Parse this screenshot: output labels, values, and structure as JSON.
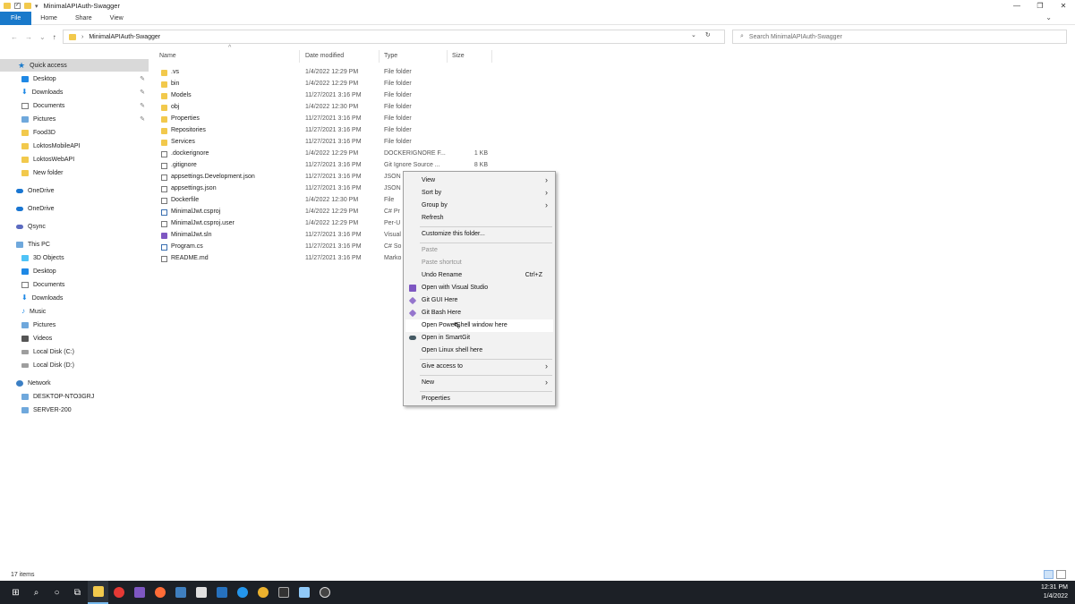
{
  "window": {
    "title": "MinimalAPIAuth-Swagger",
    "controls": [
      "—",
      "❐",
      "✕"
    ]
  },
  "ribbon": {
    "tabs": [
      "File",
      "Home",
      "Share",
      "View"
    ]
  },
  "address": {
    "path": "MinimalAPIAuth-Swagger",
    "search_placeholder": "Search MinimalAPIAuth-Swagger"
  },
  "sidebar": {
    "items": [
      {
        "label": "Quick access",
        "icon": "star-icon"
      },
      {
        "label": "Desktop",
        "icon": "desktop-icon",
        "pinned": true
      },
      {
        "label": "Downloads",
        "icon": "downloads-icon",
        "pinned": true
      },
      {
        "label": "Documents",
        "icon": "documents-icon",
        "pinned": true
      },
      {
        "label": "Pictures",
        "icon": "pictures-icon",
        "pinned": true
      },
      {
        "label": "Food3D",
        "icon": "folder-icon"
      },
      {
        "label": "LoktosMobileAPI",
        "icon": "folder-icon"
      },
      {
        "label": "LoktosWebAPI",
        "icon": "folder-icon"
      },
      {
        "label": "New folder",
        "icon": "folder-icon"
      },
      {
        "label": "OneDrive",
        "icon": "onedrive-icon"
      },
      {
        "label": "OneDrive",
        "icon": "onedrive-icon"
      },
      {
        "label": "Qsync",
        "icon": "qsync-icon"
      },
      {
        "label": "This PC",
        "icon": "pc-icon"
      },
      {
        "label": "3D Objects",
        "icon": "3d-objects-icon"
      },
      {
        "label": "Desktop",
        "icon": "desktop-icon"
      },
      {
        "label": "Documents",
        "icon": "documents-icon"
      },
      {
        "label": "Downloads",
        "icon": "downloads-icon"
      },
      {
        "label": "Music",
        "icon": "music-icon"
      },
      {
        "label": "Pictures",
        "icon": "pictures-icon"
      },
      {
        "label": "Videos",
        "icon": "videos-icon"
      },
      {
        "label": "Local Disk (C:)",
        "icon": "drive-icon"
      },
      {
        "label": "Local Disk (D:)",
        "icon": "drive-icon"
      },
      {
        "label": "Network",
        "icon": "network-icon"
      },
      {
        "label": "DESKTOP-NTO3GRJ",
        "icon": "computer-icon"
      },
      {
        "label": "SERVER-200",
        "icon": "computer-icon"
      }
    ]
  },
  "columns": {
    "name": "Name",
    "date": "Date modified",
    "type": "Type",
    "size": "Size"
  },
  "files": [
    {
      "name": ".vs",
      "date": "1/4/2022 12:29 PM",
      "type": "File folder",
      "size": "",
      "kind": "folder"
    },
    {
      "name": "bin",
      "date": "1/4/2022 12:29 PM",
      "type": "File folder",
      "size": "",
      "kind": "folder"
    },
    {
      "name": "Models",
      "date": "11/27/2021 3:16 PM",
      "type": "File folder",
      "size": "",
      "kind": "folder"
    },
    {
      "name": "obj",
      "date": "1/4/2022 12:30 PM",
      "type": "File folder",
      "size": "",
      "kind": "folder"
    },
    {
      "name": "Properties",
      "date": "11/27/2021 3:16 PM",
      "type": "File folder",
      "size": "",
      "kind": "folder"
    },
    {
      "name": "Repositories",
      "date": "11/27/2021 3:16 PM",
      "type": "File folder",
      "size": "",
      "kind": "folder"
    },
    {
      "name": "Services",
      "date": "11/27/2021 3:16 PM",
      "type": "File folder",
      "size": "",
      "kind": "folder"
    },
    {
      "name": ".dockerignore",
      "date": "1/4/2022 12:29 PM",
      "type": "DOCKERIGNORE F...",
      "size": "1 KB",
      "kind": "file"
    },
    {
      "name": ".gitignore",
      "date": "11/27/2021 3:16 PM",
      "type": "Git Ignore Source ...",
      "size": "8 KB",
      "kind": "file"
    },
    {
      "name": "appsettings.Development.json",
      "date": "11/27/2021 3:16 PM",
      "type": "JSON",
      "size": "",
      "kind": "file"
    },
    {
      "name": "appsettings.json",
      "date": "11/27/2021 3:16 PM",
      "type": "JSON",
      "size": "",
      "kind": "file"
    },
    {
      "name": "Dockerfile",
      "date": "1/4/2022 12:30 PM",
      "type": "File",
      "size": "",
      "kind": "file"
    },
    {
      "name": "MinimalJwt.csproj",
      "date": "1/4/2022 12:29 PM",
      "type": "C# Pr",
      "size": "",
      "kind": "code"
    },
    {
      "name": "MinimalJwt.csproj.user",
      "date": "1/4/2022 12:29 PM",
      "type": "Per-U",
      "size": "",
      "kind": "file"
    },
    {
      "name": "MinimalJwt.sln",
      "date": "11/27/2021 3:16 PM",
      "type": "Visual",
      "size": "",
      "kind": "proj"
    },
    {
      "name": "Program.cs",
      "date": "11/27/2021 3:16 PM",
      "type": "C# So",
      "size": "",
      "kind": "code"
    },
    {
      "name": "README.md",
      "date": "11/27/2021 3:16 PM",
      "type": "Marko",
      "size": "",
      "kind": "file"
    }
  ],
  "context_menu": {
    "items": [
      {
        "label": "View",
        "submenu": true
      },
      {
        "label": "Sort by",
        "submenu": true
      },
      {
        "label": "Group by",
        "submenu": true
      },
      {
        "label": "Refresh"
      },
      {
        "separator": true
      },
      {
        "label": "Customize this folder..."
      },
      {
        "separator": true
      },
      {
        "label": "Paste",
        "disabled": true
      },
      {
        "label": "Paste shortcut",
        "disabled": true
      },
      {
        "label": "Undo Rename",
        "shortcut": "Ctrl+Z"
      },
      {
        "label": "Open with Visual Studio",
        "icon": "visual-studio-icon",
        "icon_color": "#7e57c2"
      },
      {
        "label": "Git GUI Here",
        "icon": "git-gui-icon",
        "icon_color": "#9575cd"
      },
      {
        "label": "Git Bash Here",
        "icon": "git-bash-icon",
        "icon_color": "#9575cd"
      },
      {
        "label": "Open PowerShell window here",
        "highlighted": true
      },
      {
        "label": "Open in SmartGit",
        "icon": "smartgit-icon",
        "icon_color": "#455a64"
      },
      {
        "label": "Open Linux shell here"
      },
      {
        "separator": true
      },
      {
        "label": "Give access to",
        "submenu": true
      },
      {
        "separator": true
      },
      {
        "label": "New",
        "submenu": true
      },
      {
        "separator": true
      },
      {
        "label": "Properties"
      }
    ]
  },
  "status": {
    "item_count": "17 items"
  },
  "taskbar": {
    "apps": [
      {
        "name": "start-icon",
        "glyph": "⊞"
      },
      {
        "name": "search-icon",
        "glyph": "⌕"
      },
      {
        "name": "cortana-icon",
        "glyph": "○"
      },
      {
        "name": "task-view-icon",
        "glyph": "⧉"
      },
      {
        "name": "file-explorer-icon",
        "color": "#f2c94c",
        "active": true
      },
      {
        "name": "opera-icon",
        "color": "#e53935"
      },
      {
        "name": "visual-studio-icon",
        "color": "#7e57c2"
      },
      {
        "name": "postman-icon",
        "color": "#ff6c37"
      },
      {
        "name": "azure-data-studio-icon",
        "color": "#3f7fbf"
      },
      {
        "name": "github-desktop-icon",
        "color": "#e0e0e0"
      },
      {
        "name": "powershell-icon",
        "color": "#2671be"
      },
      {
        "name": "docker-icon",
        "color": "#2496ed"
      },
      {
        "name": "slack-icon",
        "color": "#ecb22e"
      },
      {
        "name": "terminal-icon",
        "color": "#333333"
      },
      {
        "name": "notepad-icon",
        "color": "#90caf9"
      },
      {
        "name": "obs-icon",
        "color": "#444444"
      }
    ],
    "time": "12:31 PM",
    "date": "1/4/2022"
  }
}
